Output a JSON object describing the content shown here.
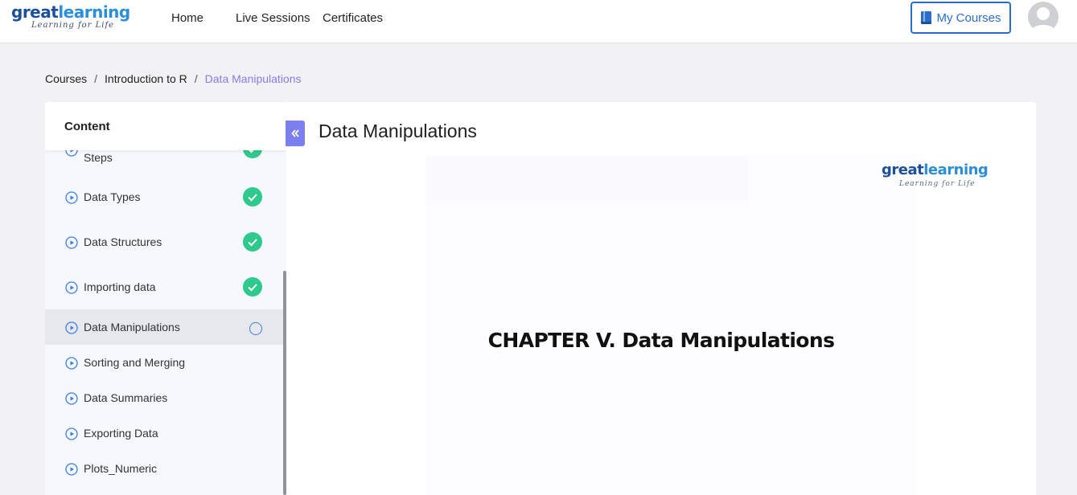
{
  "brand": {
    "name_part1": "great",
    "name_part2": "learning",
    "tagline": "Learning for Life"
  },
  "nav": {
    "home": "Home",
    "live_sessions": "Live Sessions",
    "certificates": "Certificates",
    "my_courses": "My Courses"
  },
  "breadcrumb": {
    "items": [
      "Courses",
      "Introduction to R",
      "Data Manipulations"
    ],
    "separator": "/"
  },
  "sidebar": {
    "title": "Content",
    "items": [
      {
        "label": "Steps",
        "status": "complete"
      },
      {
        "label": "Data Types",
        "status": "complete"
      },
      {
        "label": "Data Structures",
        "status": "complete"
      },
      {
        "label": "Importing data",
        "status": "complete"
      },
      {
        "label": "Data Manipulations",
        "status": "in-progress"
      },
      {
        "label": "Sorting and Merging",
        "status": "none"
      },
      {
        "label": "Data Summaries",
        "status": "none"
      },
      {
        "label": "Exporting Data",
        "status": "none"
      },
      {
        "label": "Plots_Numeric",
        "status": "none"
      }
    ]
  },
  "main": {
    "title": "Data Manipulations",
    "slide_heading": "CHAPTER V.  Data Manipulations"
  },
  "colors": {
    "accent": "#2a6ec9",
    "check": "#2ec98b",
    "breadcrumb_current": "#8a7ae6",
    "collapse": "#7b7ff0"
  }
}
